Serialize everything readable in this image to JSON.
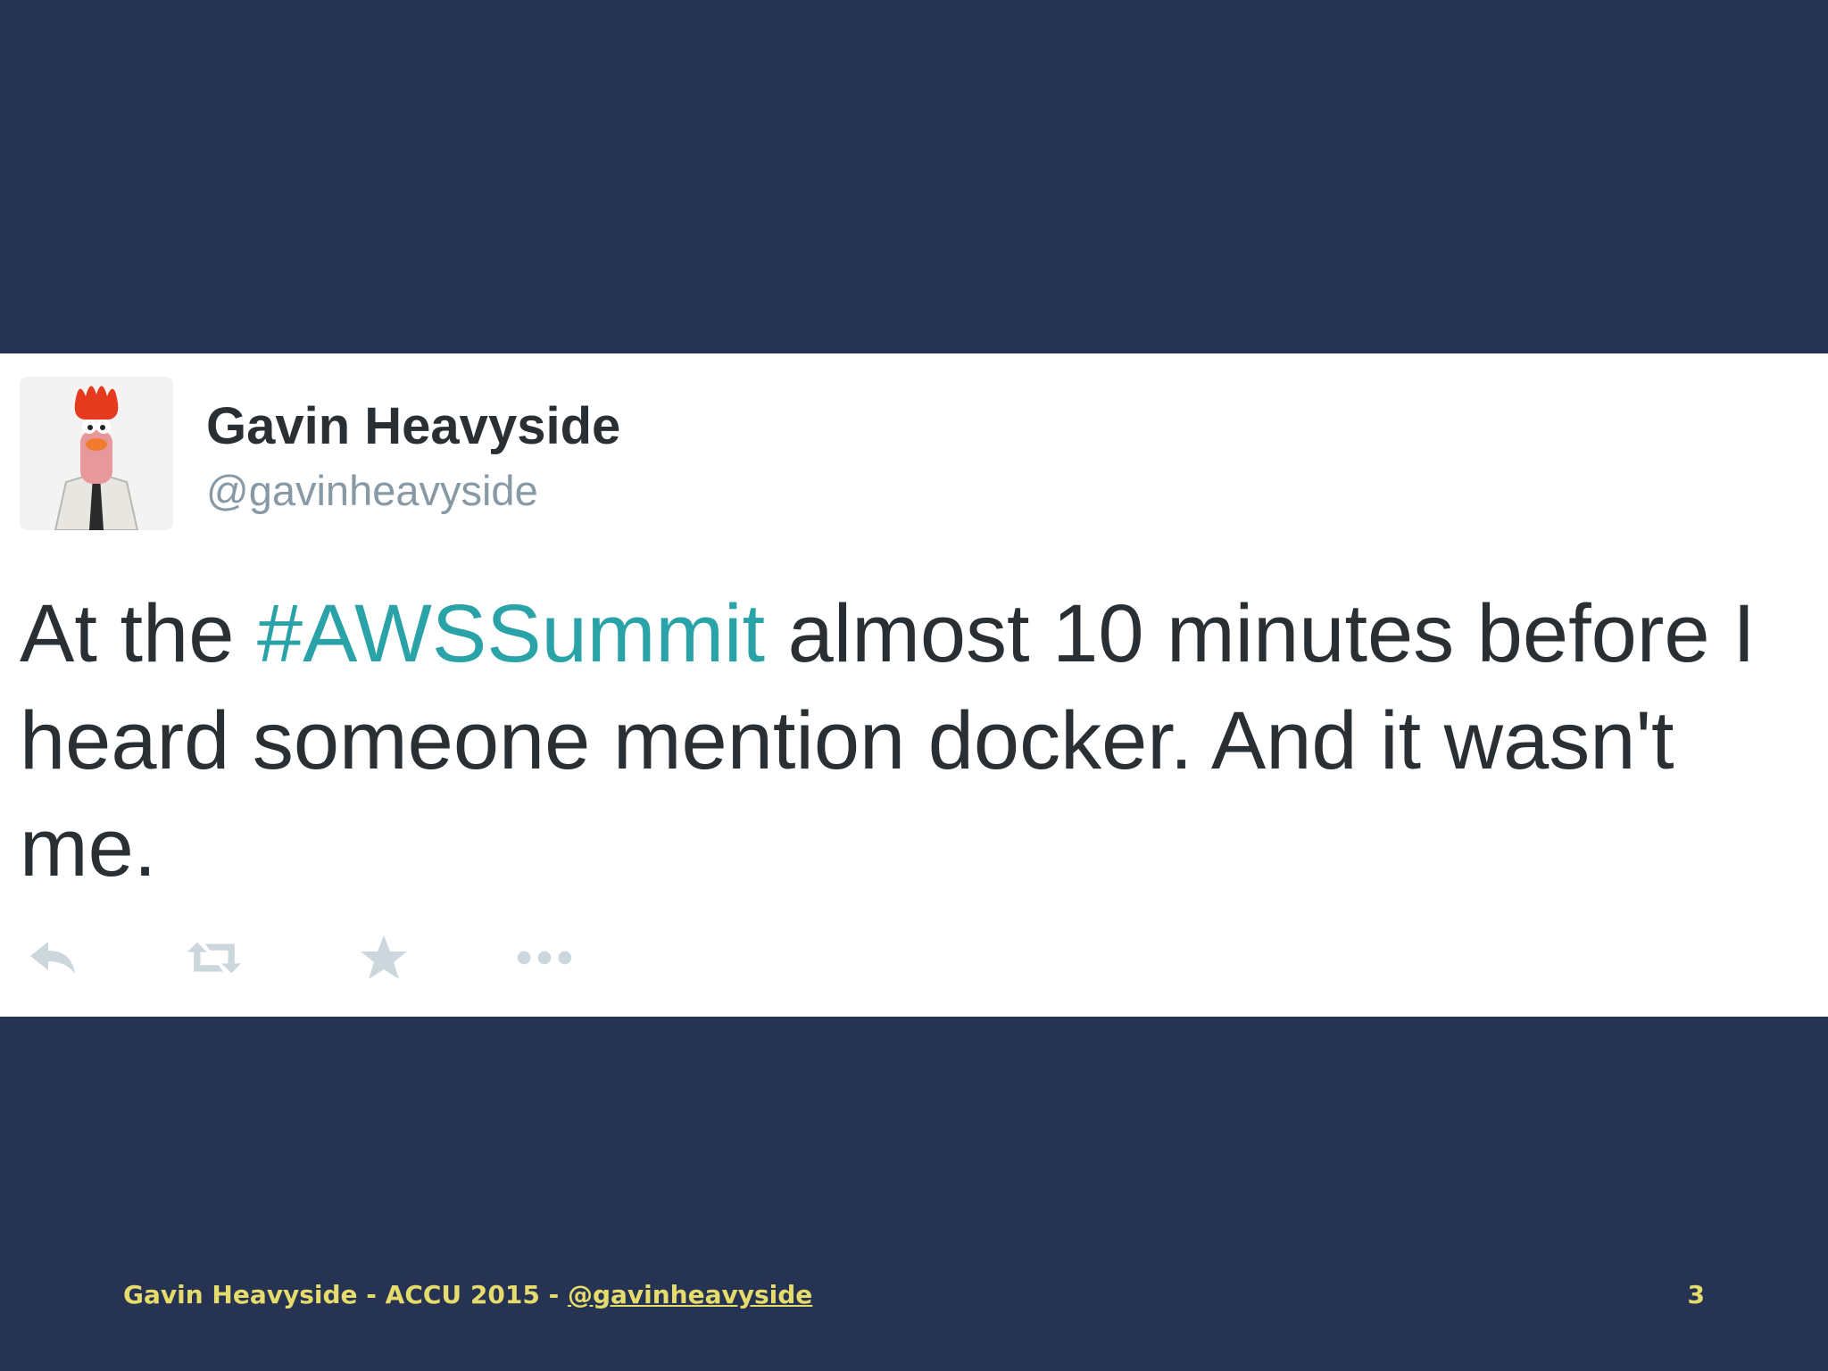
{
  "tweet": {
    "display_name": "Gavin Heavyside",
    "handle": "@gavinheavyside",
    "text_before": "At the ",
    "hashtag": "#AWSSummit",
    "text_after": " almost 10 minutes before I heard someone mention docker. And it wasn't me.",
    "hashtag_color": "#2aa3a8",
    "avatar_icon": "beaker-muppet-avatar",
    "actions": {
      "reply_icon": "reply-icon",
      "retweet_icon": "retweet-icon",
      "favorite_icon": "star-icon",
      "more_icon": "more-dots-icon",
      "icon_color": "#ccd6dd"
    }
  },
  "footer": {
    "text": "Gavin Heavyside - ACCU 2015 - ",
    "link": "@gavinheavyside",
    "page_number": "3",
    "color": "#e6dc6c"
  },
  "slide": {
    "background_color": "#263352"
  }
}
